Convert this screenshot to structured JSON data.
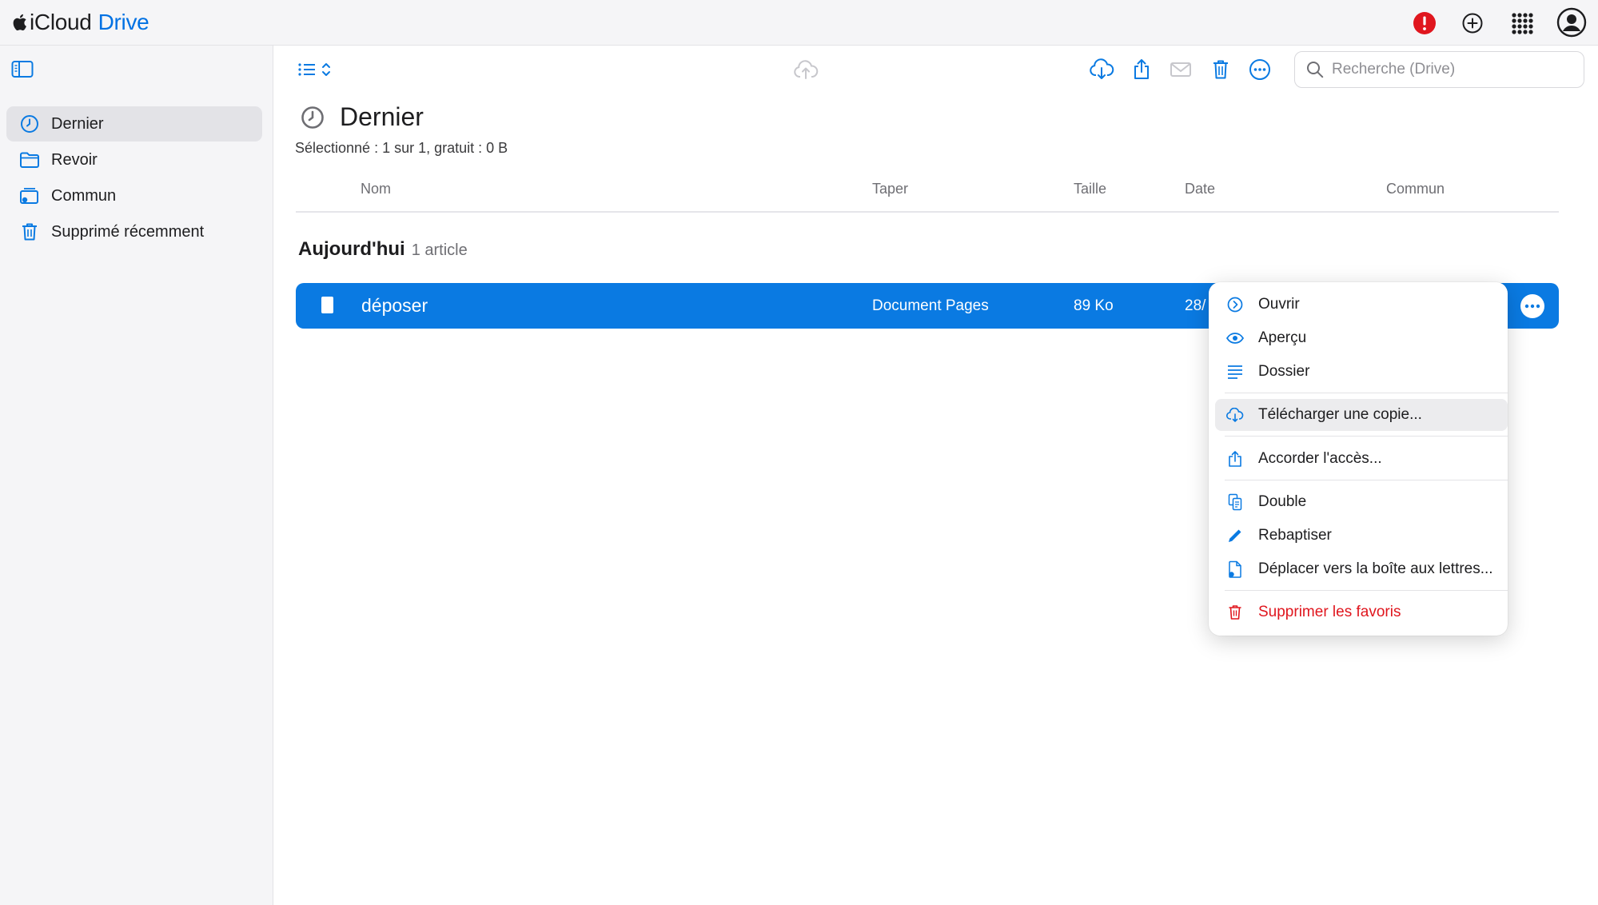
{
  "app": {
    "brand_primary": "iCloud",
    "brand_secondary": "Drive",
    "accent_color": "#0071e3",
    "alert_color": "#e0161e"
  },
  "topbar": {
    "icons": [
      "alert-icon",
      "add-circle-icon",
      "apps-grid-icon",
      "account-icon"
    ]
  },
  "sidebar": {
    "items": [
      {
        "label": "Dernier",
        "icon": "clock-icon",
        "active": true
      },
      {
        "label": "Revoir",
        "icon": "folder-icon",
        "active": false
      },
      {
        "label": "Commun",
        "icon": "shared-folder-icon",
        "active": false
      },
      {
        "label": "Supprimé récemment",
        "icon": "trash-icon",
        "active": false
      }
    ]
  },
  "toolbar": {
    "icons": [
      "list-view-icon",
      "sort-icon",
      "upload-icon",
      "download-icon",
      "share-icon",
      "mail-icon",
      "trash-icon",
      "more-icon"
    ],
    "search_placeholder": "Recherche (Drive)"
  },
  "page": {
    "title": "Dernier",
    "subtitle": "Sélectionné : 1 sur 1, gratuit : 0 B"
  },
  "table": {
    "columns": [
      "Nom",
      "Taper",
      "Taille",
      "Date",
      "Commun"
    ],
    "group": {
      "title": "Aujourd'hui",
      "count": "1 article"
    },
    "rows": [
      {
        "name": "déposer",
        "type": "Document Pages",
        "size": "89 Ko",
        "date": "28/",
        "selected": true
      }
    ]
  },
  "context_menu": {
    "items": [
      {
        "label": "Ouvrir",
        "icon": "open-icon"
      },
      {
        "label": "Aperçu",
        "icon": "eye-icon"
      },
      {
        "label": "Dossier",
        "icon": "lines-icon"
      },
      {
        "label": "Télécharger une copie...",
        "icon": "download-cloud-icon",
        "highlighted": true
      },
      {
        "label": "Accorder l'accès...",
        "icon": "share-icon"
      },
      {
        "label": "Double",
        "icon": "duplicate-icon"
      },
      {
        "label": "Rebaptiser",
        "icon": "pencil-icon"
      },
      {
        "label": "Déplacer vers la boîte aux lettres...",
        "icon": "move-doc-icon"
      },
      {
        "label": "Supprimer les favoris",
        "icon": "trash-icon",
        "danger": true
      }
    ]
  }
}
